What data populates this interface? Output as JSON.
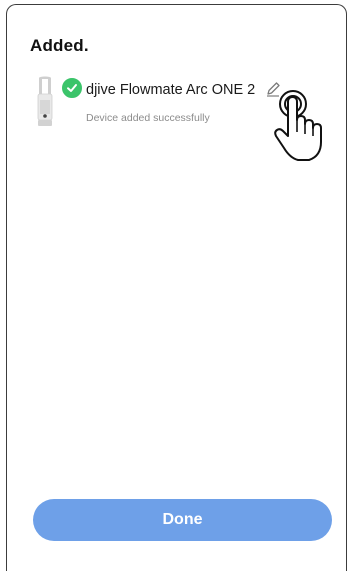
{
  "page": {
    "title": "Added."
  },
  "device": {
    "name": "djive Flowmate Arc ONE 2",
    "status": "Device added successfully",
    "icon": "purifier-tower-icon",
    "badge_icon": "check-circle-icon",
    "badge_color": "#3bc46a"
  },
  "actions": {
    "edit_icon": "pencil-icon",
    "done_label": "Done",
    "done_color": "#6ea0e8"
  },
  "overlay": {
    "hand_icon": "tap-hand-icon"
  }
}
